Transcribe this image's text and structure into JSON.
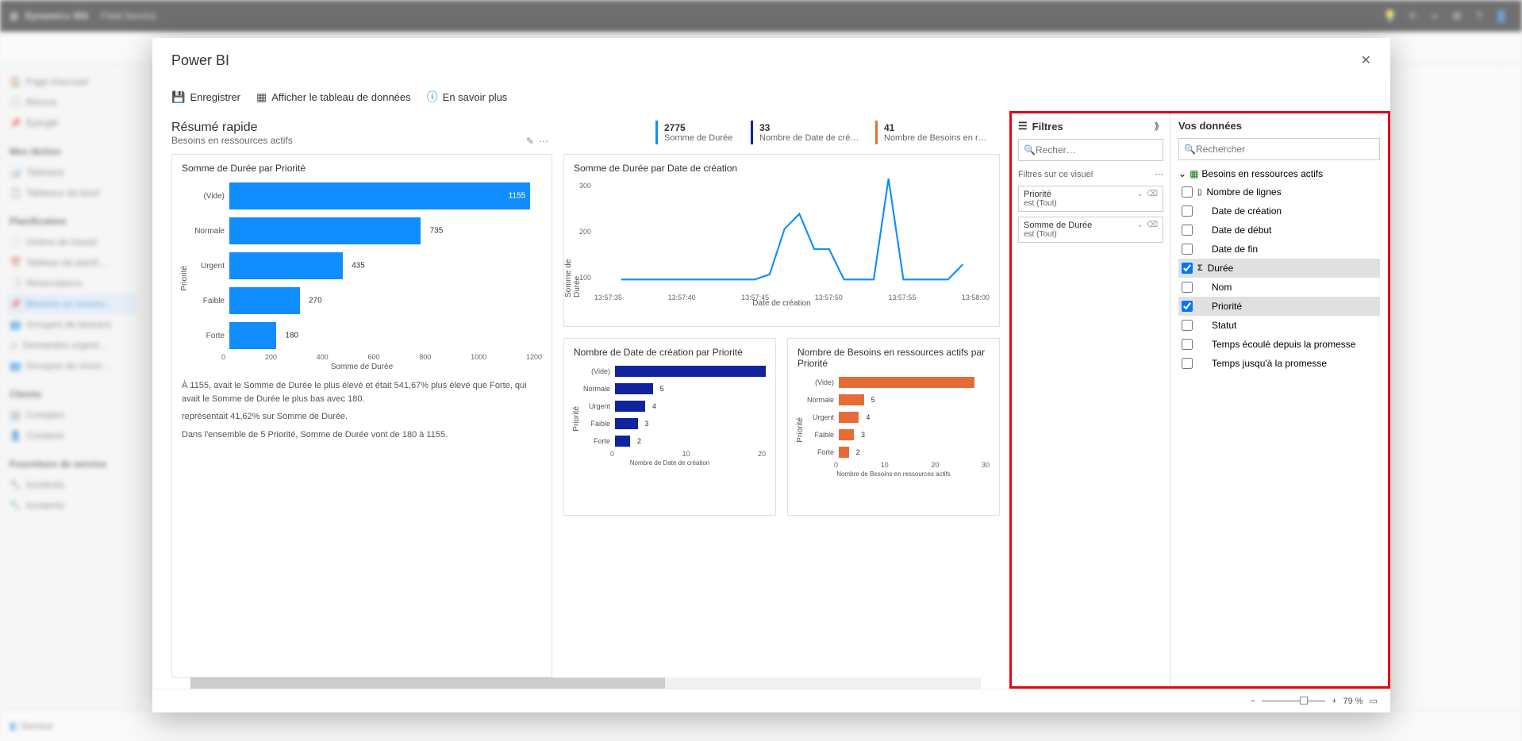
{
  "app": {
    "brand": "Dynamics 365",
    "page": "Field Service"
  },
  "bg_sidebar": {
    "items": [
      "Page d'accueil",
      "Récent",
      "Épinglé"
    ],
    "section1": "Mes tâches",
    "section1_items": [
      "Tableaux",
      "Tableaux de bord"
    ],
    "section2": "Planification",
    "section2_items": [
      "Ordres de travail",
      "Tableau de planif…",
      "Réservations",
      "Besoins en ressou…",
      "Groupes de besoins",
      "Demandes urgent…",
      "Groupes de resso…"
    ],
    "section3": "Clients",
    "section3_items": [
      "Comptes",
      "Contacts"
    ],
    "section4": "Fourniture de service",
    "section4_items": [
      "Incidents",
      "Incidents"
    ],
    "footer_label": "Service"
  },
  "modal": {
    "title": "Power BI",
    "toolbar": {
      "save": "Enregistrer",
      "show_table": "Afficher le tableau de données",
      "learn_more": "En savoir plus"
    },
    "summary": {
      "title": "Résumé rapide",
      "subtitle": "Besoins en ressources actifs"
    },
    "kpis": [
      {
        "value": "2775",
        "label": "Somme de Durée",
        "cls": "c1"
      },
      {
        "value": "33",
        "label": "Nombre de Date de créa…",
        "cls": "c2"
      },
      {
        "value": "41",
        "label": "Nombre de Besoins en re…",
        "cls": "c3"
      }
    ],
    "chart1": {
      "title": "Somme de Durée par Priorité",
      "xlabel": "Somme de Durée",
      "ylabel": "Priorité"
    },
    "chart2": {
      "title": "Somme de Durée par Date de création",
      "xlabel": "Date de création",
      "ylabel": "Somme de Durée"
    },
    "chart3": {
      "title": "Nombre de Date de création par Priorité",
      "xlabel": "Nombre de Date de création",
      "ylabel": "Priorité"
    },
    "chart4": {
      "title": "Nombre de Besoins en ressources actifs par Priorité",
      "xlabel": "Nombre de Besoins en ressources actifs",
      "ylabel": "Priorité"
    },
    "insights": [
      "À 1155,  avait le Somme de Durée le plus élevé et était 541,67% plus élevé que Forte, qui avait le Somme de Durée le plus bas avec 180.",
      " représentait 41,62% sur Somme de Durée.",
      "Dans l'ensemble de 5 Priorité, Somme de Durée vont de 180 à 1155."
    ],
    "chart2_ticks": [
      "13:57:35",
      "13:57:40",
      "13:57:45",
      "13:57:50",
      "13:57:55",
      "13:58:00"
    ],
    "chart2_yticks": [
      "100",
      "200",
      "300"
    ]
  },
  "filters": {
    "title": "Filtres",
    "search_placeholder": "Recher…",
    "section": "Filtres sur ce visuel",
    "cards": [
      {
        "name": "Priorité",
        "value": "est (Tout)"
      },
      {
        "name": "Somme de Durée",
        "value": "est (Tout)"
      }
    ]
  },
  "data_pane": {
    "title": "Vos données",
    "search_placeholder": "Rechercher",
    "table": "Besoins en ressources actifs",
    "fields": [
      {
        "label": "Nombre de lignes",
        "checked": false,
        "sigma": false,
        "agg": true
      },
      {
        "label": "Date de création",
        "checked": false
      },
      {
        "label": "Date de début",
        "checked": false
      },
      {
        "label": "Date de fin",
        "checked": false
      },
      {
        "label": "Durée",
        "checked": true,
        "sigma": true,
        "selected": true
      },
      {
        "label": "Nom",
        "checked": false
      },
      {
        "label": "Priorité",
        "checked": true,
        "selected": true
      },
      {
        "label": "Statut",
        "checked": false
      },
      {
        "label": "Temps écoulé depuis la promesse",
        "checked": false
      },
      {
        "label": "Temps jusqu'à la promesse",
        "checked": false
      }
    ]
  },
  "zoom": {
    "percent": "79 %"
  },
  "chart_data": [
    {
      "type": "bar",
      "orientation": "horizontal",
      "title": "Somme de Durée par Priorité",
      "categories": [
        "(Vide)",
        "Normale",
        "Urgent",
        "Faible",
        "Forte"
      ],
      "values": [
        1155,
        735,
        435,
        270,
        180
      ],
      "xlabel": "Somme de Durée",
      "ylabel": "Priorité",
      "xlim": [
        0,
        1200
      ],
      "xticks": [
        0,
        200,
        400,
        600,
        800,
        1000,
        1200
      ],
      "color": "#118dff"
    },
    {
      "type": "line",
      "title": "Somme de Durée par Date de création",
      "x": [
        "13:57:35",
        "13:57:36",
        "13:57:37",
        "13:57:38",
        "13:57:39",
        "13:57:40",
        "13:57:41",
        "13:57:42",
        "13:57:43",
        "13:57:44",
        "13:57:45",
        "13:57:46",
        "13:57:47",
        "13:57:48",
        "13:57:49",
        "13:57:50",
        "13:57:51",
        "13:57:52",
        "13:57:53",
        "13:57:54",
        "13:57:55",
        "13:57:56",
        "13:57:57",
        "13:58:00"
      ],
      "y": [
        100,
        100,
        100,
        100,
        100,
        100,
        100,
        100,
        100,
        100,
        110,
        200,
        230,
        160,
        160,
        100,
        100,
        100,
        300,
        100,
        100,
        100,
        100,
        130
      ],
      "xlabel": "Date de création",
      "ylabel": "Somme de Durée",
      "ylim": [
        0,
        300
      ],
      "yticks": [
        100,
        200,
        300
      ],
      "color": "#118dff"
    },
    {
      "type": "bar",
      "orientation": "horizontal",
      "title": "Nombre de Date de création par Priorité",
      "categories": [
        "(Vide)",
        "Normale",
        "Urgent",
        "Faible",
        "Forte"
      ],
      "values": [
        20,
        5,
        4,
        3,
        2
      ],
      "xlabel": "Nombre de Date de création",
      "ylabel": "Priorité",
      "xlim": [
        0,
        20
      ],
      "xticks": [
        0,
        10,
        20
      ],
      "color": "#12239e"
    },
    {
      "type": "bar",
      "orientation": "horizontal",
      "title": "Nombre de Besoins en ressources actifs par Priorité",
      "categories": [
        "(Vide)",
        "Normale",
        "Urgent",
        "Faible",
        "Forte"
      ],
      "values": [
        27,
        5,
        4,
        3,
        2
      ],
      "xlabel": "Nombre de Besoins en ressources actifs",
      "ylabel": "Priorité",
      "xlim": [
        0,
        30
      ],
      "xticks": [
        0,
        10,
        20,
        30
      ],
      "color": "#e66c37"
    }
  ]
}
